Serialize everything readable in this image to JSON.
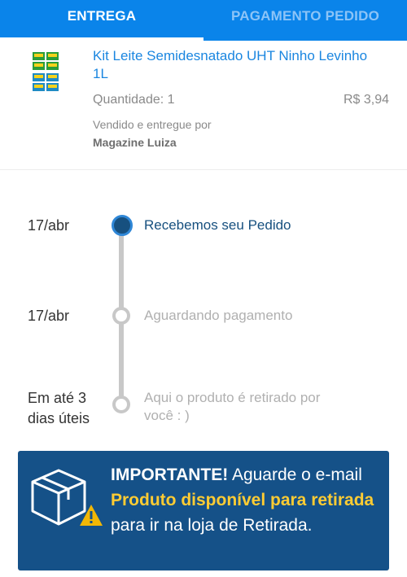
{
  "tabs": [
    {
      "label": "ENTREGA",
      "active": true
    },
    {
      "label": "PAGAMENTO PEDIDO",
      "active": false
    }
  ],
  "product": {
    "name": "Kit Leite Semidesnatado UHT Ninho Levinho 1L",
    "quantity": "Quantidade: 1",
    "price": "R$ 3,94",
    "sold_by": "Vendido e entregue por",
    "seller": "Magazine Luiza"
  },
  "timeline": [
    {
      "date": "17/abr",
      "status": "Recebemos seu Pedido",
      "done": true
    },
    {
      "date": "17/abr",
      "status": "Aguardando pagamento",
      "done": false
    },
    {
      "date_line1": "Em até 3",
      "date_line2": "dias úteis",
      "status": "Aqui o produto é retirado por você : )",
      "done": false
    }
  ],
  "notice": {
    "important": "IMPORTANTE!",
    "text1": " Aguarde o e-mail ",
    "highlight": "Produto disponível para retirada",
    "text2": " para ir na loja de Retirada."
  },
  "colors": {
    "tab_bar": "#0a84ea",
    "link": "#1a86e0",
    "timeline_active": "#17507f",
    "notice_bg": "#155188",
    "notice_highlight": "#ffcc33",
    "warning": "#f2b705"
  },
  "icons": [
    "milk-carton-icon",
    "box-warning-icon"
  ]
}
